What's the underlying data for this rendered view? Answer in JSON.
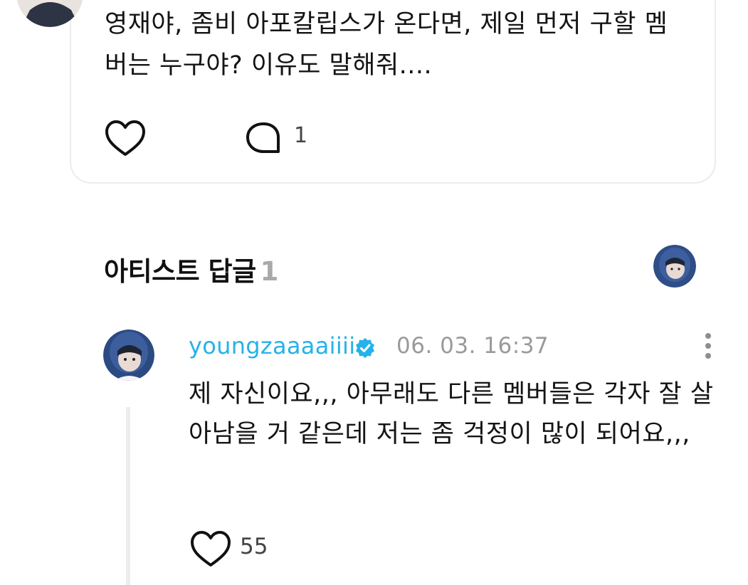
{
  "post": {
    "text": "영재야, 좀비 아포칼립스가 온다면, 제일 먼저 구할 멤버는 누구야? 이유도 말해줘....",
    "comment_count": "1",
    "avatar_icon": "user-avatar-photo",
    "like_icon": "heart-outline-icon",
    "comment_icon": "speech-bubble-icon"
  },
  "artist_replies": {
    "title": "아티스트 답글",
    "count": "1",
    "header_avatar_icon": "artist-avatar-photo"
  },
  "reply": {
    "username": "youngzaaaaiiii",
    "verified_icon": "verified-badge-icon",
    "timestamp": "06. 03. 16:37",
    "text": "제 자신이요,,, 아무래도 다른 멤버들은 각자 잘 살아남을 거 같은데 저는 좀 걱정이 많이 되어요,,,",
    "like_count": "55",
    "more_icon": "more-vertical-icon"
  },
  "colors": {
    "username": "#26b2e8",
    "verified": "#26b2e8",
    "muted": "#9a9a9a",
    "border": "#ececec"
  }
}
